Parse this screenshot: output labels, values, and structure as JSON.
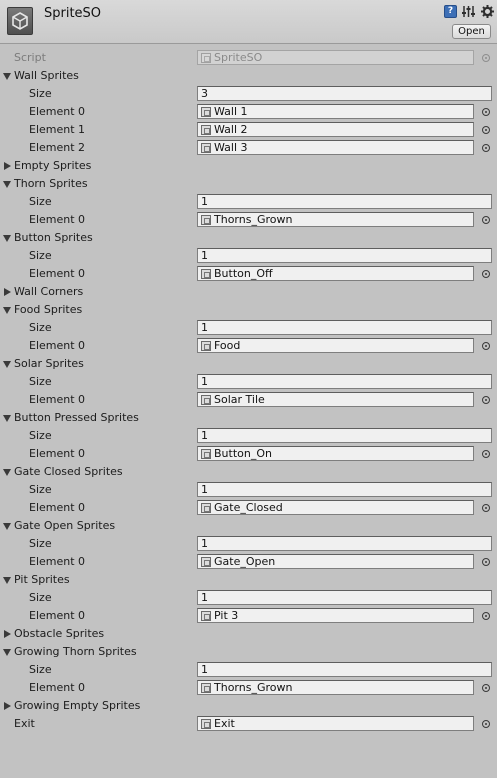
{
  "header": {
    "title": "SpriteSO",
    "open_label": "Open",
    "help_glyph": "?"
  },
  "rows": [
    {
      "kind": "object",
      "label": "Script",
      "value": "SpriteSO",
      "disabled": true
    },
    {
      "kind": "foldout",
      "label": "Wall Sprites",
      "expanded": true
    },
    {
      "kind": "int",
      "label": "Size",
      "value": "3"
    },
    {
      "kind": "object",
      "label": "Element 0",
      "value": "Wall 1"
    },
    {
      "kind": "object",
      "label": "Element 1",
      "value": "Wall 2"
    },
    {
      "kind": "object",
      "label": "Element 2",
      "value": "Wall 3"
    },
    {
      "kind": "foldout",
      "label": "Empty Sprites",
      "expanded": false
    },
    {
      "kind": "foldout",
      "label": "Thorn Sprites",
      "expanded": true
    },
    {
      "kind": "int",
      "label": "Size",
      "value": "1"
    },
    {
      "kind": "object",
      "label": "Element 0",
      "value": "Thorns_Grown"
    },
    {
      "kind": "foldout",
      "label": "Button Sprites",
      "expanded": true
    },
    {
      "kind": "int",
      "label": "Size",
      "value": "1"
    },
    {
      "kind": "object",
      "label": "Element 0",
      "value": "Button_Off"
    },
    {
      "kind": "foldout",
      "label": "Wall Corners",
      "expanded": false
    },
    {
      "kind": "foldout",
      "label": "Food Sprites",
      "expanded": true
    },
    {
      "kind": "int",
      "label": "Size",
      "value": "1"
    },
    {
      "kind": "object",
      "label": "Element 0",
      "value": "Food"
    },
    {
      "kind": "foldout",
      "label": "Solar Sprites",
      "expanded": true
    },
    {
      "kind": "int",
      "label": "Size",
      "value": "1"
    },
    {
      "kind": "object",
      "label": "Element 0",
      "value": "Solar Tile"
    },
    {
      "kind": "foldout",
      "label": "Button Pressed Sprites",
      "expanded": true
    },
    {
      "kind": "int",
      "label": "Size",
      "value": "1"
    },
    {
      "kind": "object",
      "label": "Element 0",
      "value": "Button_On"
    },
    {
      "kind": "foldout",
      "label": "Gate Closed Sprites",
      "expanded": true
    },
    {
      "kind": "int",
      "label": "Size",
      "value": "1"
    },
    {
      "kind": "object",
      "label": "Element 0",
      "value": "Gate_Closed"
    },
    {
      "kind": "foldout",
      "label": "Gate Open Sprites",
      "expanded": true
    },
    {
      "kind": "int",
      "label": "Size",
      "value": "1"
    },
    {
      "kind": "object",
      "label": "Element 0",
      "value": "Gate_Open"
    },
    {
      "kind": "foldout",
      "label": "Pit Sprites",
      "expanded": true
    },
    {
      "kind": "int",
      "label": "Size",
      "value": "1"
    },
    {
      "kind": "object",
      "label": "Element 0",
      "value": "Pit 3"
    },
    {
      "kind": "foldout",
      "label": "Obstacle Sprites",
      "expanded": false
    },
    {
      "kind": "foldout",
      "label": "Growing Thorn Sprites",
      "expanded": true
    },
    {
      "kind": "int",
      "label": "Size",
      "value": "1"
    },
    {
      "kind": "object",
      "label": "Element 0",
      "value": "Thorns_Grown"
    },
    {
      "kind": "foldout",
      "label": "Growing Empty Sprites",
      "expanded": false
    },
    {
      "kind": "object",
      "label": "Exit",
      "value": "Exit"
    }
  ]
}
